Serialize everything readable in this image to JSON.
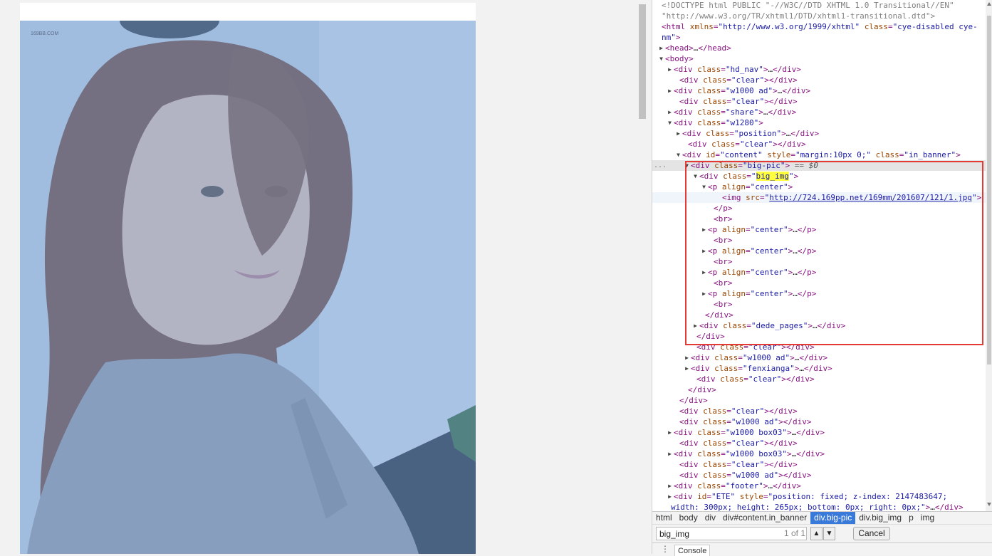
{
  "page": {
    "watermark": "169BB.COM",
    "photo_description_icon": "portrait-photo"
  },
  "devtools": {
    "tree_lines": [
      {
        "tw": "",
        "html": "<span class=\"doc\">&lt;!DOCTYPE html PUBLIC \"-//W3C//DTD XHTML 1.0 Transitional//EN\"</span>"
      },
      {
        "tw": "",
        "html": "<span class=\"doc\">\"http://www.w3.org/TR/xhtml1/DTD/xhtml1-transitional.dtd\"&gt;</span>"
      },
      {
        "tw": "",
        "html": "<span class=\"tag\">&lt;html</span> <span class=\"an\">xmlns</span>=<span class=\"av\">\"http://www.w3.org/1999/xhtml\"</span> <span class=\"an\">class</span>=<span class=\"av\">\"cye-disabled cye-</span>"
      },
      {
        "tw": "",
        "html": "<span class=\"av\">nm\"</span><span class=\"tag\">&gt;</span>"
      },
      {
        "tw": "▶",
        "html": "<span class=\"tag\">&lt;head&gt;</span><span class=\"tx\">…</span><span class=\"tag\">&lt;/head&gt;</span>"
      },
      {
        "tw": "▼",
        "html": "<span class=\"tag\">&lt;body&gt;</span>"
      },
      {
        "tw": "▶",
        "html": "<span class=\"tag\">&lt;div</span> <span class=\"an\">class</span>=<span class=\"av\">\"hd_nav\"</span><span class=\"tag\">&gt;</span><span class=\"tx\">…</span><span class=\"tag\">&lt;/div&gt;</span>"
      },
      {
        "tw": "",
        "html": "<span class=\"tag\">&lt;div</span> <span class=\"an\">class</span>=<span class=\"av\">\"clear\"</span><span class=\"tag\">&gt;&lt;/div&gt;</span>"
      },
      {
        "tw": "▶",
        "html": "<span class=\"tag\">&lt;div</span> <span class=\"an\">class</span>=<span class=\"av\">\"w1000 ad\"</span><span class=\"tag\">&gt;</span><span class=\"tx\">…</span><span class=\"tag\">&lt;/div&gt;</span>"
      },
      {
        "tw": "",
        "html": "<span class=\"tag\">&lt;div</span> <span class=\"an\">class</span>=<span class=\"av\">\"clear\"</span><span class=\"tag\">&gt;&lt;/div&gt;</span>"
      },
      {
        "tw": "▶",
        "html": "<span class=\"tag\">&lt;div</span> <span class=\"an\">class</span>=<span class=\"av\">\"share\"</span><span class=\"tag\">&gt;</span><span class=\"tx\">…</span><span class=\"tag\">&lt;/div&gt;</span>"
      },
      {
        "tw": "▼",
        "html": "<span class=\"tag\">&lt;div</span> <span class=\"an\">class</span>=<span class=\"av\">\"w1280\"</span><span class=\"tag\">&gt;</span>"
      },
      {
        "tw": "▶",
        "html": "<span class=\"tag\">&lt;div</span> <span class=\"an\">class</span>=<span class=\"av\">\"position\"</span><span class=\"tag\">&gt;</span><span class=\"tx\">…</span><span class=\"tag\">&lt;/div&gt;</span>"
      },
      {
        "tw": "",
        "html": "<span class=\"tag\">&lt;div</span> <span class=\"an\">class</span>=<span class=\"av\">\"clear\"</span><span class=\"tag\">&gt;&lt;/div&gt;</span>"
      },
      {
        "tw": "▼",
        "html": "<span class=\"tag\">&lt;div</span> <span class=\"an\">id</span>=<span class=\"av\">\"content\"</span> <span class=\"an\">style</span>=<span class=\"av\">\"margin:10px 0;\"</span> <span class=\"an\">class</span>=<span class=\"av\">\"in_banner\"</span><span class=\"tag\">&gt;</span>"
      },
      {
        "tw": "▼",
        "html": "<span class=\"tag\">&lt;div</span> <span class=\"an\">class</span>=<span class=\"av\">\"big-pic\"</span><span class=\"tag\">&gt;</span> <span class=\"eq\">== $0</span>"
      },
      {
        "tw": "▼",
        "html": "<span class=\"tag\">&lt;div</span> <span class=\"an\">class</span>=<span class=\"av\">\"<span class=\"hl\">big_img</span>\"</span><span class=\"tag\">&gt;</span>"
      },
      {
        "tw": "▼",
        "html": "<span class=\"tag\">&lt;p</span> <span class=\"an\">align</span>=<span class=\"av\">\"center\"</span><span class=\"tag\">&gt;</span>"
      },
      {
        "tw": "",
        "html": "<span class=\"tag\">&lt;img</span> <span class=\"an\">src</span>=<span class=\"av\">\"</span><span class=\"lnk\">http://724.169pp.net/169mm/201607/121/1.jpg</span><span class=\"av\">\"</span><span class=\"tag\">&gt;</span>"
      },
      {
        "tw": "",
        "html": "<span class=\"tag\">&lt;/p&gt;</span>"
      },
      {
        "tw": "",
        "html": "<span class=\"tag\">&lt;br&gt;</span>"
      },
      {
        "tw": "▶",
        "html": "<span class=\"tag\">&lt;p</span> <span class=\"an\">align</span>=<span class=\"av\">\"center\"</span><span class=\"tag\">&gt;</span><span class=\"tx\">…</span><span class=\"tag\">&lt;/p&gt;</span>"
      },
      {
        "tw": "",
        "html": "<span class=\"tag\">&lt;br&gt;</span>"
      },
      {
        "tw": "▶",
        "html": "<span class=\"tag\">&lt;p</span> <span class=\"an\">align</span>=<span class=\"av\">\"center\"</span><span class=\"tag\">&gt;</span><span class=\"tx\">…</span><span class=\"tag\">&lt;/p&gt;</span>"
      },
      {
        "tw": "",
        "html": "<span class=\"tag\">&lt;br&gt;</span>"
      },
      {
        "tw": "▶",
        "html": "<span class=\"tag\">&lt;p</span> <span class=\"an\">align</span>=<span class=\"av\">\"center\"</span><span class=\"tag\">&gt;</span><span class=\"tx\">…</span><span class=\"tag\">&lt;/p&gt;</span>"
      },
      {
        "tw": "",
        "html": "<span class=\"tag\">&lt;br&gt;</span>"
      },
      {
        "tw": "▶",
        "html": "<span class=\"tag\">&lt;p</span> <span class=\"an\">align</span>=<span class=\"av\">\"center\"</span><span class=\"tag\">&gt;</span><span class=\"tx\">…</span><span class=\"tag\">&lt;/p&gt;</span>"
      },
      {
        "tw": "",
        "html": "<span class=\"tag\">&lt;br&gt;</span>"
      },
      {
        "tw": "",
        "html": "<span class=\"tag\">&lt;/div&gt;</span>"
      },
      {
        "tw": "▶",
        "html": "<span class=\"tag\">&lt;div</span> <span class=\"an\">class</span>=<span class=\"av\">\"dede_pages\"</span><span class=\"tag\">&gt;</span><span class=\"tx\">…</span><span class=\"tag\">&lt;/div&gt;</span>"
      },
      {
        "tw": "",
        "html": "<span class=\"tag\">&lt;/div&gt;</span>"
      },
      {
        "tw": "",
        "html": "<span class=\"tag\">&lt;div</span> <span class=\"an\">class</span>=<span class=\"av\">\"clear\"</span><span class=\"tag\">&gt;&lt;/div&gt;</span>"
      },
      {
        "tw": "▶",
        "html": "<span class=\"tag\">&lt;div</span> <span class=\"an\">class</span>=<span class=\"av\">\"w1000 ad\"</span><span class=\"tag\">&gt;</span><span class=\"tx\">…</span><span class=\"tag\">&lt;/div&gt;</span>"
      },
      {
        "tw": "▶",
        "html": "<span class=\"tag\">&lt;div</span> <span class=\"an\">class</span>=<span class=\"av\">\"fenxianga\"</span><span class=\"tag\">&gt;</span><span class=\"tx\">…</span><span class=\"tag\">&lt;/div&gt;</span>"
      },
      {
        "tw": "",
        "html": "<span class=\"tag\">&lt;div</span> <span class=\"an\">class</span>=<span class=\"av\">\"clear\"</span><span class=\"tag\">&gt;&lt;/div&gt;</span>"
      },
      {
        "tw": "",
        "html": "<span class=\"tag\">&lt;/div&gt;</span>"
      },
      {
        "tw": "",
        "html": "<span class=\"tag\">&lt;/div&gt;</span>"
      },
      {
        "tw": "",
        "html": "<span class=\"tag\">&lt;div</span> <span class=\"an\">class</span>=<span class=\"av\">\"clear\"</span><span class=\"tag\">&gt;&lt;/div&gt;</span>"
      },
      {
        "tw": "",
        "html": "<span class=\"tag\">&lt;div</span> <span class=\"an\">class</span>=<span class=\"av\">\"w1000 ad\"</span><span class=\"tag\">&gt;&lt;/div&gt;</span>"
      },
      {
        "tw": "▶",
        "html": "<span class=\"tag\">&lt;div</span> <span class=\"an\">class</span>=<span class=\"av\">\"w1000 box03\"</span><span class=\"tag\">&gt;</span><span class=\"tx\">…</span><span class=\"tag\">&lt;/div&gt;</span>"
      },
      {
        "tw": "",
        "html": "<span class=\"tag\">&lt;div</span> <span class=\"an\">class</span>=<span class=\"av\">\"clear\"</span><span class=\"tag\">&gt;&lt;/div&gt;</span>"
      },
      {
        "tw": "▶",
        "html": "<span class=\"tag\">&lt;div</span> <span class=\"an\">class</span>=<span class=\"av\">\"w1000 box03\"</span><span class=\"tag\">&gt;</span><span class=\"tx\">…</span><span class=\"tag\">&lt;/div&gt;</span>"
      },
      {
        "tw": "",
        "html": "<span class=\"tag\">&lt;div</span> <span class=\"an\">class</span>=<span class=\"av\">\"clear\"</span><span class=\"tag\">&gt;&lt;/div&gt;</span>"
      },
      {
        "tw": "",
        "html": "<span class=\"tag\">&lt;div</span> <span class=\"an\">class</span>=<span class=\"av\">\"w1000 ad\"</span><span class=\"tag\">&gt;&lt;/div&gt;</span>"
      },
      {
        "tw": "▶",
        "html": "<span class=\"tag\">&lt;div</span> <span class=\"an\">class</span>=<span class=\"av\">\"footer\"</span><span class=\"tag\">&gt;</span><span class=\"tx\">…</span><span class=\"tag\">&lt;/div&gt;</span>"
      },
      {
        "tw": "▶",
        "html": "<span class=\"tag\">&lt;div</span> <span class=\"an\">id</span>=<span class=\"av\">\"ETE\"</span> <span class=\"an\">style</span>=<span class=\"av\">\"position: fixed; z-index: 2147483647;</span>"
      },
      {
        "tw": "",
        "html": "<span class=\"av\">width: 300px; height: 265px; bottom: 0px; right: 0px;\"</span><span class=\"tag\">&gt;</span><span class=\"tx\">…</span><span class=\"tag\">&lt;/div&gt;</span>"
      }
    ],
    "breadcrumbs": [
      "html",
      "body",
      "div",
      "div#content.in_banner",
      "div.big-pic",
      "div.big_img",
      "p",
      "img"
    ],
    "active_crumb": "div.big-pic",
    "search": {
      "value": "big_img",
      "count": "1 of 1",
      "up_label": "▲",
      "down_label": "▼",
      "cancel_label": "Cancel"
    },
    "console": {
      "menu_icon": "⋮",
      "tab_label": "Console"
    }
  }
}
